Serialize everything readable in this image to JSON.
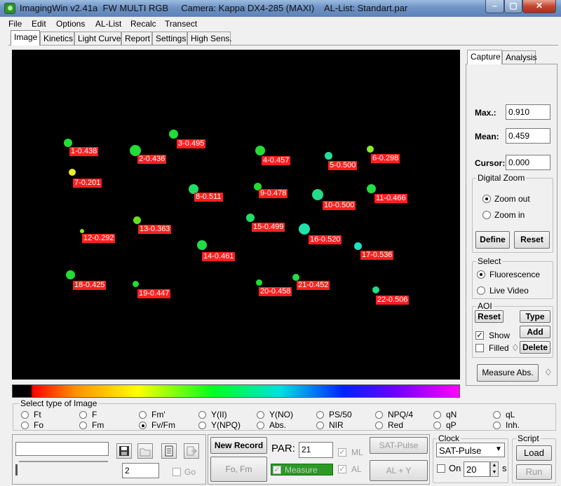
{
  "window": {
    "title": "ImagingWin v2.41a  FW MULTI RGB     Camera: Kappa DX4-285 (MAXI)    AL-List: Standart.par",
    "min": "–",
    "max": "▢",
    "close": "✕"
  },
  "menu": [
    "File",
    "Edit",
    "Options",
    "AL-List",
    "Recalc",
    "Transect"
  ],
  "tabs": [
    "Image",
    "Kinetics",
    "Light Curve",
    "Report",
    "Settings",
    "High Sens."
  ],
  "spots": [
    {
      "label": "1-0.438",
      "color": "#22dd33"
    },
    {
      "label": "2-0.436",
      "color": "#22dd33"
    },
    {
      "label": "3-0.495",
      "color": "#22dd33"
    },
    {
      "label": "4-0.457",
      "color": "#22dd33"
    },
    {
      "label": "5-0.500",
      "color": "#20e0a0"
    },
    {
      "label": "6-0.298",
      "color": "#88ee22"
    },
    {
      "label": "7-0.201",
      "color": "#eeee22"
    },
    {
      "label": "8-0.511",
      "color": "#22dd66"
    },
    {
      "label": "9-0.478",
      "color": "#22dd33"
    },
    {
      "label": "10-0.500",
      "color": "#22dd88"
    },
    {
      "label": "11-0.466",
      "color": "#22dd44"
    },
    {
      "label": "12-0.292",
      "color": "#88ee22"
    },
    {
      "label": "13-0.363",
      "color": "#66e022"
    },
    {
      "label": "14-0.461",
      "color": "#22dd44"
    },
    {
      "label": "15-0.499",
      "color": "#22dd66"
    },
    {
      "label": "16-0.520",
      "color": "#22e0aa"
    },
    {
      "label": "17-0.536",
      "color": "#22e0bb"
    },
    {
      "label": "18-0.425",
      "color": "#22dd33"
    },
    {
      "label": "19-0.447",
      "color": "#22dd33"
    },
    {
      "label": "20-0.458",
      "color": "#22dd33"
    },
    {
      "label": "21-0.452",
      "color": "#22dd44"
    },
    {
      "label": "22-0.506",
      "color": "#22dd88"
    }
  ],
  "right_panel": {
    "tabs": [
      "Capture",
      "Analysis"
    ],
    "max_label": "Max.:",
    "max_value": "0.910",
    "mean_label": "Mean:",
    "mean_value": "0.459",
    "cursor_label": "Cursor:",
    "cursor_value": "0.000",
    "digital_zoom": {
      "title": "Digital Zoom",
      "zoom_out": "Zoom out",
      "zoom_in": "Zoom in",
      "selected": "Zoom out",
      "define": "Define",
      "reset": "Reset"
    },
    "select": {
      "title": "Select",
      "fluorescence": "Fluorescence",
      "live_video": "Live Video",
      "selected": "Fluorescence"
    },
    "aoi": {
      "title": "AOI",
      "reset": "Reset",
      "type": "Type",
      "show": "Show",
      "show_checked": true,
      "add": "Add",
      "filled": "Filled",
      "filled_checked": false,
      "delete": "Delete"
    },
    "measure_abs": "Measure Abs."
  },
  "image_type": {
    "title": "Select type of Image",
    "row1": [
      "Ft",
      "F",
      "Fm'",
      "Y(II)",
      "Y(NO)",
      "PS/50",
      "NPQ/4",
      "qN",
      "qL"
    ],
    "row2": [
      "Fo",
      "Fm",
      "Fv/Fm",
      "Y(NPQ)",
      "Abs.",
      "NIR",
      "Red",
      "qP",
      "Inh."
    ],
    "selected": "Fv/Fm"
  },
  "bottom": {
    "counter_value": "2",
    "go_label": "Go",
    "new_record": "New Record",
    "fo_fm": "Fo, Fm",
    "par_label": "PAR:",
    "par_value": "21",
    "ml_label": "ML",
    "al_label": "AL",
    "measure_label": "Measure",
    "sat_pulse_btn": "SAT-Pulse",
    "al_y_btn": "AL + Y",
    "clock": {
      "title": "Clock",
      "select_value": "SAT-Pulse",
      "on_label": "On",
      "interval": "20",
      "unit": "s"
    },
    "script": {
      "title": "Script",
      "load": "Load",
      "run": "Run"
    }
  }
}
